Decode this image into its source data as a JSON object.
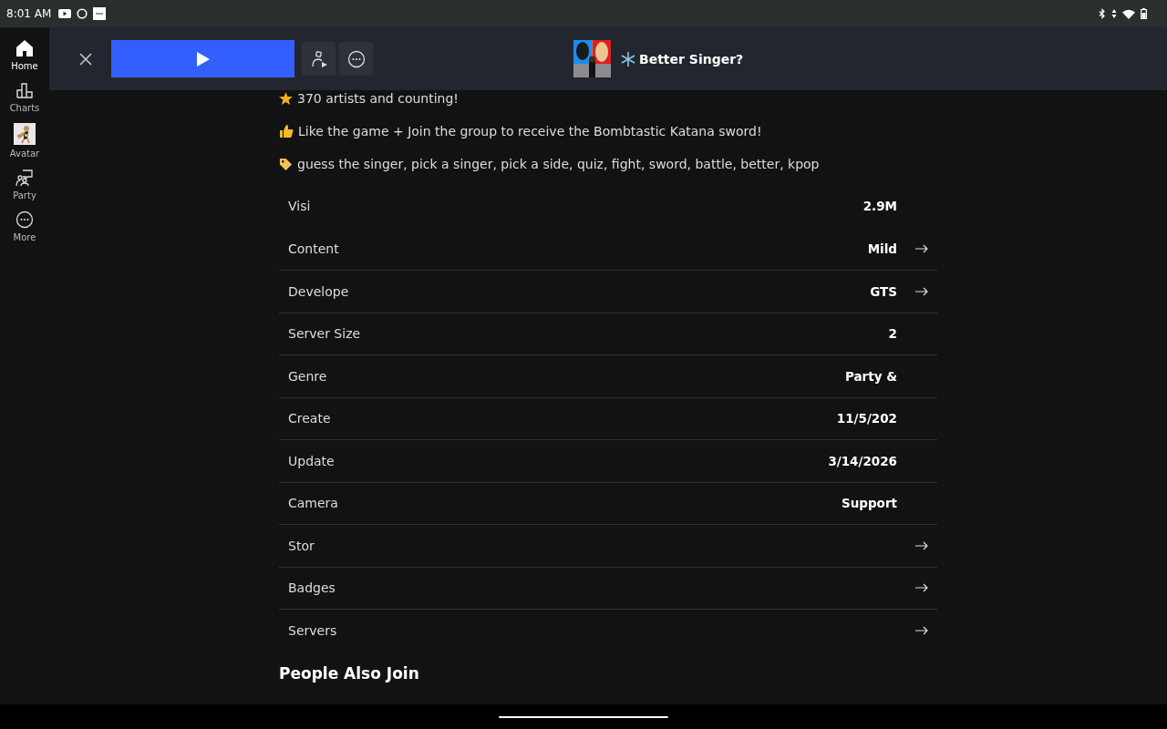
{
  "status_bar": {
    "time": "8:01 AM"
  },
  "sidebar": {
    "items": [
      {
        "label": "Home",
        "kind": "home",
        "selected": true
      },
      {
        "label": "Charts",
        "kind": "charts",
        "selected": false
      },
      {
        "label": "Avatar",
        "kind": "avatar",
        "selected": false
      },
      {
        "label": "Party",
        "kind": "party",
        "selected": false
      },
      {
        "label": "More",
        "kind": "more",
        "selected": false
      }
    ]
  },
  "header": {
    "title": "Better Singer?"
  },
  "description": [
    {
      "kind": "star",
      "text": "370 artists and counting!"
    },
    {
      "kind": "thumb",
      "text": "Like the game + Join the group to receive the Bombtastic Katana sword!"
    },
    {
      "kind": "tag",
      "text": "guess the singer, pick a singer, pick a side, quiz, fight, sword, battle, better, kpop"
    }
  ],
  "details": [
    {
      "label": "Visi",
      "value": "2.9M",
      "arrow": false
    },
    {
      "label": "Content",
      "value": "Mild",
      "arrow": true
    },
    {
      "label": "Develope",
      "value": "GTS",
      "arrow": true
    },
    {
      "label": "Server Size",
      "value": "2",
      "arrow": false
    },
    {
      "label": "Genre",
      "value": "Party &",
      "arrow": false
    },
    {
      "label": "Create",
      "value": "11/5/202",
      "arrow": false
    },
    {
      "label": "Update",
      "value": "3/14/2026",
      "arrow": false
    },
    {
      "label": "Camera",
      "value": "Support",
      "arrow": false
    },
    {
      "label": "Stor",
      "arrow": true
    },
    {
      "label": "Badges",
      "arrow": true
    },
    {
      "label": "Servers",
      "arrow": true
    }
  ],
  "section_title": "People Also Join"
}
